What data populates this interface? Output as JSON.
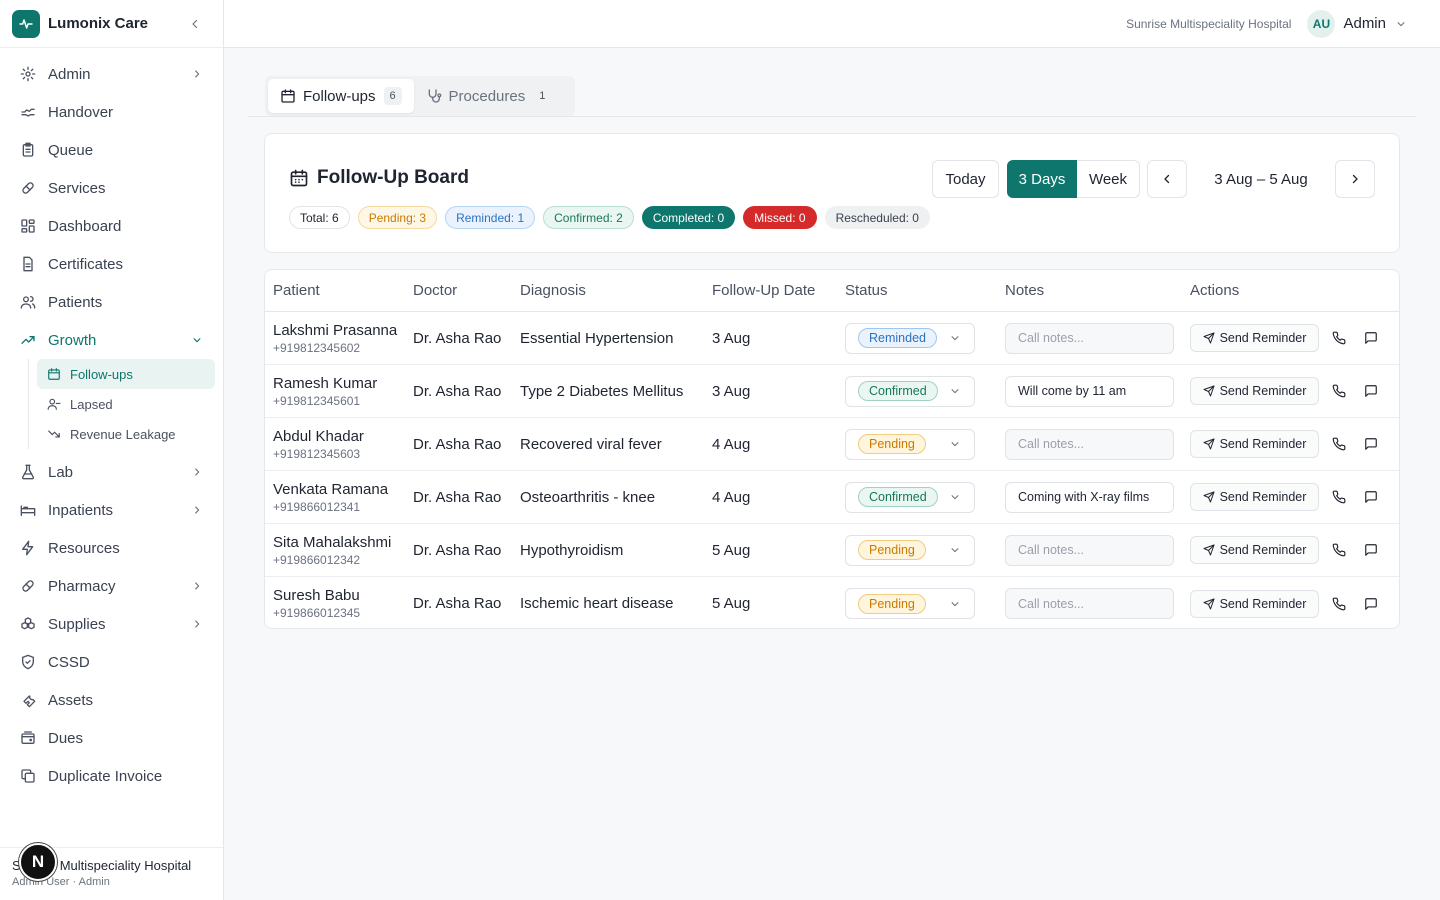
{
  "brand": {
    "name": "Lumonix Care"
  },
  "sidebar": {
    "items": [
      {
        "label": "Admin",
        "icon": "gear-icon",
        "chevron": true
      },
      {
        "label": "Handover",
        "icon": "handover-icon",
        "chevron": false
      },
      {
        "label": "Queue",
        "icon": "clipboard-icon",
        "chevron": false
      },
      {
        "label": "Services",
        "icon": "pill-icon",
        "chevron": false
      },
      {
        "label": "Dashboard",
        "icon": "dashboard-icon",
        "chevron": false
      },
      {
        "label": "Certificates",
        "icon": "document-icon",
        "chevron": false
      },
      {
        "label": "Patients",
        "icon": "users-icon",
        "chevron": false
      },
      {
        "label": "Growth",
        "icon": "trending-up-icon",
        "chevron": "down"
      }
    ],
    "growth_sub": [
      {
        "label": "Follow-ups",
        "icon": "calendar-icon",
        "active": true
      },
      {
        "label": "Lapsed",
        "icon": "user-minus-icon",
        "active": false
      },
      {
        "label": "Revenue Leakage",
        "icon": "trending-down-icon",
        "active": false
      }
    ],
    "items_after": [
      {
        "label": "Lab",
        "icon": "flask-icon",
        "chevron": true
      },
      {
        "label": "Inpatients",
        "icon": "bed-icon",
        "chevron": true
      },
      {
        "label": "Resources",
        "icon": "zap-icon",
        "chevron": false
      },
      {
        "label": "Pharmacy",
        "icon": "pill-icon",
        "chevron": true
      },
      {
        "label": "Supplies",
        "icon": "boxes-icon",
        "chevron": true
      },
      {
        "label": "CSSD",
        "icon": "shield-icon",
        "chevron": false
      },
      {
        "label": "Assets",
        "icon": "wrench-icon",
        "chevron": false
      },
      {
        "label": "Dues",
        "icon": "wallet-icon",
        "chevron": false
      },
      {
        "label": "Duplicate Invoice",
        "icon": "copy-icon",
        "chevron": false
      }
    ],
    "footer": {
      "hospital": "Sunrise Multispeciality Hospital",
      "user": "Admin User · Admin",
      "badge": "N"
    }
  },
  "topbar": {
    "hospital": "Sunrise Multispeciality Hospital",
    "avatar": "AU",
    "user": "Admin"
  },
  "tabs": [
    {
      "label": "Follow-ups",
      "count": "6",
      "icon": "calendar-icon"
    },
    {
      "label": "Procedures",
      "count": "1",
      "icon": "stethoscope-icon"
    }
  ],
  "board": {
    "title": "Follow-Up Board",
    "chips": {
      "total": "Total: 6",
      "pending": "Pending: 3",
      "reminded": "Reminded: 1",
      "confirmed": "Confirmed: 2",
      "completed": "Completed: 0",
      "missed": "Missed: 0",
      "rescheduled": "Rescheduled: 0"
    },
    "today": "Today",
    "days3": "3 Days",
    "week": "Week",
    "range": "3 Aug – 5 Aug"
  },
  "table": {
    "headers": [
      "Patient",
      "Doctor",
      "Diagnosis",
      "Follow-Up Date",
      "Status",
      "Notes",
      "Actions"
    ],
    "notes_placeholder": "Call notes...",
    "send_label": "Send Reminder",
    "rows": [
      {
        "name": "Lakshmi Prasanna",
        "phone": "+919812345602",
        "doctor": "Dr. Asha Rao",
        "diagnosis": "Essential Hypertension",
        "date": "3 Aug",
        "status": "Reminded",
        "notes": ""
      },
      {
        "name": "Ramesh Kumar",
        "phone": "+919812345601",
        "doctor": "Dr. Asha Rao",
        "diagnosis": "Type 2 Diabetes Mellitus",
        "date": "3 Aug",
        "status": "Confirmed",
        "notes": "Will come by 11 am"
      },
      {
        "name": "Abdul Khadar",
        "phone": "+919812345603",
        "doctor": "Dr. Asha Rao",
        "diagnosis": "Recovered viral fever",
        "date": "4 Aug",
        "status": "Pending",
        "notes": ""
      },
      {
        "name": "Venkata Ramana",
        "phone": "+919866012341",
        "doctor": "Dr. Asha Rao",
        "diagnosis": "Osteoarthritis - knee",
        "date": "4 Aug",
        "status": "Confirmed",
        "notes": "Coming with X-ray films"
      },
      {
        "name": "Sita Mahalakshmi",
        "phone": "+919866012342",
        "doctor": "Dr. Asha Rao",
        "diagnosis": "Hypothyroidism",
        "date": "5 Aug",
        "status": "Pending",
        "notes": ""
      },
      {
        "name": "Suresh Babu",
        "phone": "+919866012345",
        "doctor": "Dr. Asha Rao",
        "diagnosis": "Ischemic heart disease",
        "date": "5 Aug",
        "status": "Pending",
        "notes": ""
      }
    ]
  },
  "colors": {
    "accent": "#0f766e",
    "missed": "#d42a2a",
    "pending": "#c77c02",
    "reminded": "#2a72c4"
  }
}
